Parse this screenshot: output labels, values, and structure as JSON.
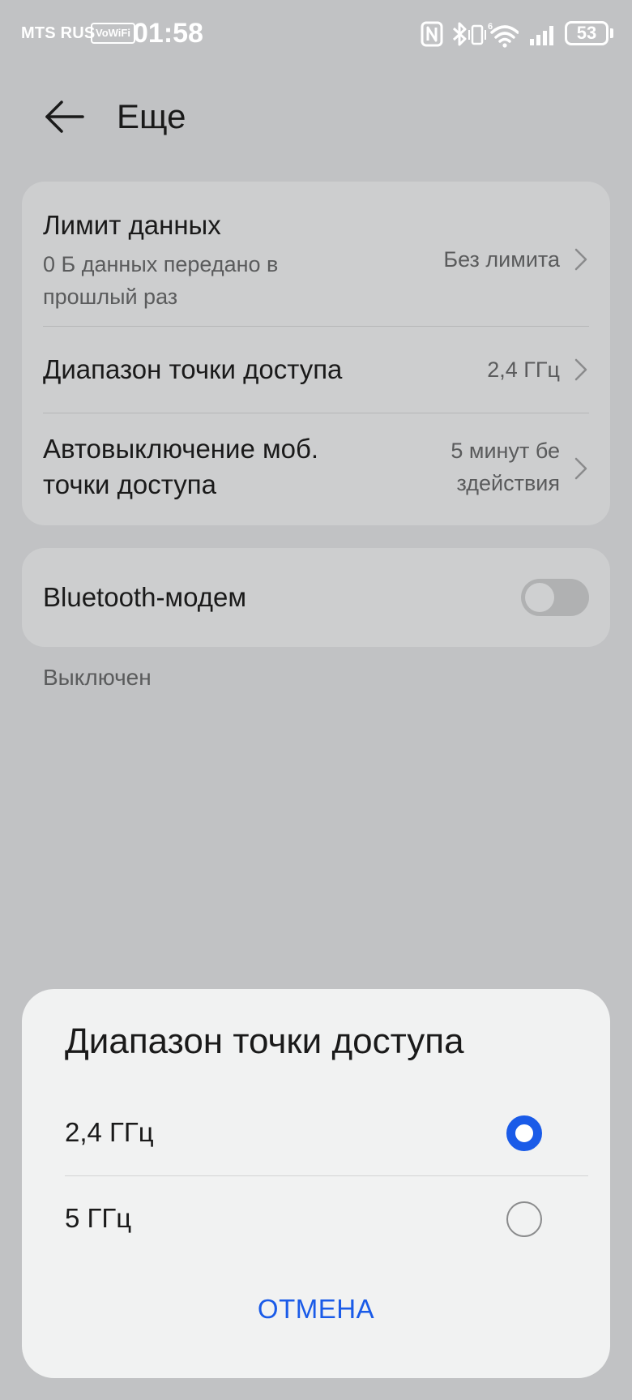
{
  "status_bar": {
    "carrier": "MTS RUS",
    "vowifi": "VoWiFi",
    "time": "01:58",
    "battery": "53",
    "icons": [
      "nfc-icon",
      "bluetooth-icon",
      "vibrate-icon",
      "wifi-icon",
      "signal-icon",
      "battery-icon"
    ]
  },
  "header": {
    "title": "Еще",
    "back_icon": "arrow-left-icon"
  },
  "settings": {
    "data_limit": {
      "title": "Лимит данных",
      "subtitle": "0 Б данных передано в прошлый раз",
      "value": "Без лимита"
    },
    "ap_band": {
      "title": "Диапазон точки доступа",
      "value": "2,4 ГГц"
    },
    "auto_off": {
      "title": "Автовыключение моб. точки доступа",
      "value": "5 минут бе здействия"
    },
    "bluetooth_tethering": {
      "title": "Bluetooth-модем",
      "enabled": false
    },
    "bluetooth_status": "Выключен"
  },
  "dialog": {
    "title": "Диапазон точки доступа",
    "options": [
      {
        "label": "2,4 ГГц",
        "selected": true
      },
      {
        "label": "5 ГГц",
        "selected": false
      }
    ],
    "cancel_label": "ОТМЕНА"
  },
  "colors": {
    "accent": "#1a5be8",
    "background_dimmed": "#c1c2c4",
    "dialog_background": "#f1f2f2"
  }
}
